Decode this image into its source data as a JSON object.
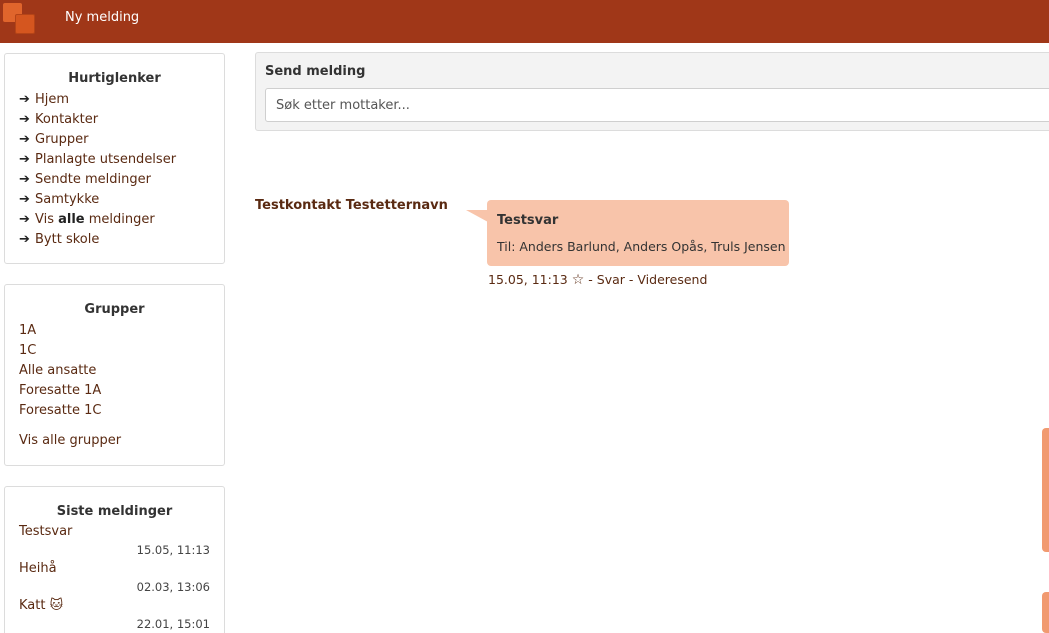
{
  "app": {
    "title": "Ny melding"
  },
  "colors": {
    "topbar": "#a03718",
    "bubble": "#f8c4aa",
    "link": "#5a2a12"
  },
  "quicklinks": {
    "heading": "Hurtiglenker",
    "items": [
      {
        "label": "Hjem"
      },
      {
        "label": "Kontakter"
      },
      {
        "label": "Grupper"
      },
      {
        "label": "Planlagte utsendelser"
      },
      {
        "label": "Sendte meldinger"
      },
      {
        "label": "Samtykke"
      },
      {
        "label_pre": "Vis ",
        "label_bold": "alle",
        "label_post": " meldinger"
      },
      {
        "label": "Bytt skole"
      }
    ]
  },
  "groups": {
    "heading": "Grupper",
    "items": [
      "1A",
      "1C",
      "Alle ansatte",
      "Foresatte 1A",
      "Foresatte 1C"
    ],
    "show_all": "Vis alle grupper"
  },
  "recent": {
    "heading": "Siste meldinger",
    "items": [
      {
        "name": "Testsvar",
        "time": "15.05, 11:13"
      },
      {
        "name": "Heihå",
        "time": "02.03, 13:06"
      },
      {
        "name": "Katt 🐱",
        "time": "22.01, 15:01"
      }
    ]
  },
  "send": {
    "label": "Send melding",
    "placeholder": "Søk etter mottaker..."
  },
  "conversation": {
    "sender": "Testkontakt Testetternavn",
    "message_title": "Testsvar",
    "recipients": "Til: Anders Barlund, Anders Opås, Truls Jensen",
    "timestamp": "15.05, 11:13",
    "star_icon": "☆",
    "sep1": " - ",
    "reply": "Svar",
    "sep2": " - ",
    "forward": "Videresend"
  }
}
